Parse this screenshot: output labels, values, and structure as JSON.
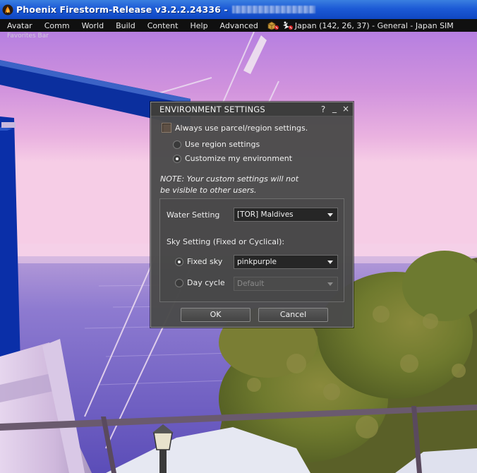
{
  "window": {
    "title": "Phoenix Firestorm-Release v3.2.2.24336 -"
  },
  "menubar": {
    "items": [
      "Avatar",
      "Comm",
      "World",
      "Build",
      "Content",
      "Help",
      "Advanced"
    ],
    "location": "Japan (142, 26, 37) - General - Japan SIM"
  },
  "favorites_bar": "Favorites Bar",
  "floater": {
    "title": "ENVIRONMENT SETTINGS",
    "help_label": "?",
    "minimize_label": "_",
    "close_label": "×",
    "always_use_parcel": {
      "label": "Always use parcel/region settings.",
      "checked": false
    },
    "env_mode": {
      "options": [
        "Use region settings",
        "Customize my environment"
      ],
      "selected": "Customize my environment"
    },
    "note": {
      "line1": "NOTE: Your custom settings will not",
      "line2": "be visible to other users."
    },
    "water": {
      "label": "Water Setting",
      "value": "[TOR] Maldives"
    },
    "sky": {
      "label": "Sky Setting (Fixed or Cyclical):",
      "fixed_label": "Fixed sky",
      "fixed_value": "pinkpurple",
      "cycle_label": "Day cycle",
      "cycle_value": "Default",
      "selected": "Fixed sky"
    },
    "ok_label": "OK",
    "cancel_label": "Cancel"
  },
  "colors": {
    "titlebar": "#1c5ad6",
    "menubar": "#101010",
    "floater_bg": "#4a4a4a",
    "sky_top": "#c98ad8",
    "sky_horizon": "#f2c6e4",
    "water": "#7f6fc8",
    "tower_blue": "#0a2fa8"
  },
  "icons": [
    "app-logo-icon",
    "landmark-icon",
    "fly-icon",
    "help-icon",
    "minimize-icon",
    "close-icon",
    "dropdown-arrow-icon"
  ]
}
